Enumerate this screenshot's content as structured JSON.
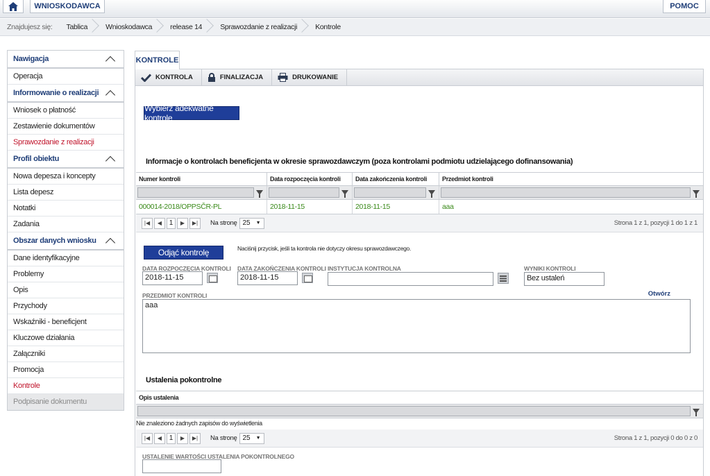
{
  "topbar": {
    "app_label": "WNIOSKODAWCA",
    "help_label": "POMOC"
  },
  "breadcrumb": {
    "lead": "Znajdujesz się:",
    "items": [
      "Tablica",
      "Wnioskodawca",
      "release 14",
      "Sprawozdanie z realizacji",
      "Kontrole"
    ]
  },
  "sidebar": {
    "sections": [
      {
        "title": "Nawigacja",
        "items": [
          "Operacja"
        ]
      },
      {
        "title": "Informowanie o realizacji",
        "items": [
          "Wniosek o płatność",
          "Zestawienie dokumentów",
          "Sprawozdanie z realizacji"
        ]
      },
      {
        "title": "Profil obiektu",
        "items": [
          "Nowa depesza i koncepty",
          "Lista depesz",
          "Notatki",
          "Zadania"
        ]
      },
      {
        "title": "Obszar danych wniosku",
        "items": [
          "Dane identyfikacyjne",
          "Problemy",
          "Opis",
          "Przychody",
          "Wskaźniki - beneficjent",
          "Kluczowe działania",
          "Załączniki",
          "Promocja",
          "Kontrole",
          "Podpisanie dokumentu"
        ]
      }
    ]
  },
  "main": {
    "tab_label": "KONTROLE",
    "toolbar": {
      "kontrola": "KONTROLA",
      "finalizacja": "FINALIZACJA",
      "drukowanie": "DRUKOWANIE"
    },
    "select_button": "Wybierz adekwatne kontrole",
    "section1_title": "Informacje o kontrolach beneficjenta w okresie sprawozdawczym (poza kontrolami podmiotu udzielającego dofinansowania)",
    "grid1": {
      "columns": [
        "Numer kontroli",
        "Data rozpoczęcia kontroli",
        "Data zakończenia kontroli",
        "Przedmiot kontroli"
      ],
      "rows": [
        [
          "000014-2018/OPPSČR-PL",
          "2018-11-15",
          "2018-11-15",
          "aaa"
        ]
      ],
      "pager": {
        "page": "1",
        "per_page_label": "Na stronę",
        "per_page": "25",
        "info": "Strona 1 z 1, pozycji 1 do 1 z 1"
      }
    },
    "remove_button": "Odjąć kontrolę",
    "remove_hint": "Naciśnij przycisk, jeśli ta kontrola nie dotyczy okresu sprawozdawczego.",
    "form": {
      "start_label": "DATA ROZPOCZĘCIA KONTROLI",
      "start_value": "2018-11-15",
      "end_label": "DATA ZAKOŃCZENIA KONTROLI",
      "end_value": "2018-11-15",
      "institution_label": "INSTYTUCJA KONTROLNA",
      "institution_value": "",
      "result_label": "WYNIKI KONTROLI",
      "result_value": "Bez ustaleń",
      "subject_label": "PRZEDMIOT KONTROLI",
      "subject_value": "aaa",
      "open_link": "Otwórz"
    },
    "section2_title": "Ustalenia pokontrolne",
    "grid2": {
      "columns": [
        "Opis ustalenia"
      ],
      "empty_text": "Nie znaleziono żadnych zapisów do wyświetlenia",
      "pager": {
        "page": "1",
        "per_page_label": "Na stronę",
        "per_page": "25",
        "info": "Strona 1 z 1, pozycji 0 do 0 z 0"
      }
    },
    "value_label": "USTALENIE WARTOŚCI USTALENIA POKONTROLNEGO"
  }
}
